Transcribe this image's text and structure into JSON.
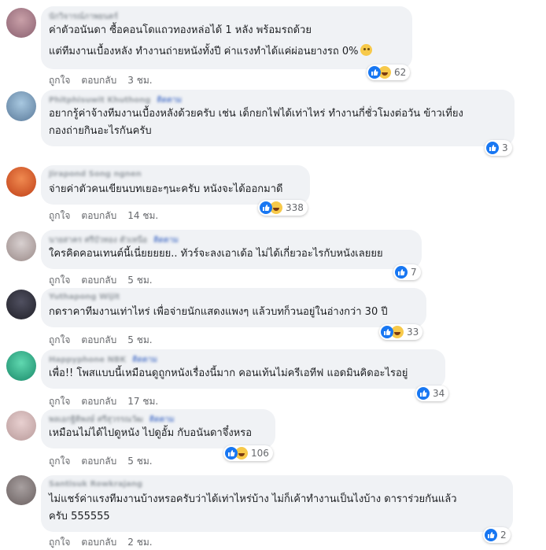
{
  "meta": {
    "like": "ถูกใจ",
    "reply": "ตอบกลับ"
  },
  "comments": [
    {
      "author": "นักวิจารณ์ภาพยนตร์",
      "tag": "",
      "lines": [
        "ค่าตัวอนันดา ซื้อคอนโดแถวทองหล่อได้ 1 หลัง พร้อมรถด้วย",
        "แต่ทีมงานเบื้องหลัง ทำงานถ่ายหนังทั้งปี ค่าแรงทำได้แค่ผ่อนยางรถ 0%"
      ],
      "time": "3 ชม.",
      "count": "62"
    },
    {
      "author": "Phitphisuwit Khuthong",
      "tag": "ติดตาม",
      "lines": [
        "อยากรู้ค่าจ้างทีมงานเบื้องหลังด้วยครับ เช่น เด็กยกไฟได้เท่าไหร่ ทำงานกี่ชั่วโมงต่อวัน ข้าวเที่ยง",
        "กองถ่ายกินอะไรกันครับ"
      ],
      "time": "",
      "count": "3"
    },
    {
      "author": "Jirapond Song ngnen",
      "tag": "",
      "lines": [
        "จ่ายค่าตัวคนเขียนบทเยอะๆนะครับ หนังจะได้ออกมาดี"
      ],
      "time": "14 ชม.",
      "count": "338"
    },
    {
      "author": "นายสาคร ศรีบัวทอง ตัวเหนือ",
      "tag": "ติดตาม",
      "lines": [
        "ใครคิดคอนเทนต์นี้เนี่ยยยยย.. ทัวร์จะลงเอาเด้อ ไม่ได้เกี่ยวอะไรกับหนังเลยยย"
      ],
      "time": "5 ชม.",
      "count": "7"
    },
    {
      "author": "Yuthapong Wijit",
      "tag": "",
      "lines": [
        "กดราคาทีมงานเท่าไหร่ เพื่อจ่ายนักแสดงแพงๆ แล้วบทก็วนอยู่ในอ่างกว่า 30 ปี"
      ],
      "time": "5 ชม.",
      "count": "33"
    },
    {
      "author": "Happyphone NBK",
      "tag": "ติดตาม",
      "lines": [
        "เพื่อ!! โพสแบบนี้เหมือนดูถูกหนังเรื่องนี้มาก คอนเท้นไม่ครีเอทีฟ แอดมินคิดอะไรอยู่"
      ],
      "time": "17 ชม.",
      "count": "34"
    },
    {
      "author": "พลเอกฐิติพงษ์ ศรีสุวรรณวัฒ",
      "tag": "ติดตาม",
      "lines": [
        "เหมือนไม่ได้ไปดูหนัง ไปดูอั้ม กับอนันดาจึ๋งหรอ"
      ],
      "time": "5 ชม.",
      "count": "106"
    },
    {
      "author": "Santisuk Rowkrajang",
      "tag": "",
      "lines": [
        "ไม่แชร์ค่าแรงทีมงานบ้างหรอครับว่าได้เท่าไหร่บ้าง ไม่ก็เค้าทำงานเป็นไงบ้าง ดาราร่วยกันแล้ว",
        "ครับ 555555"
      ],
      "time": "2 ชม.",
      "count": "2"
    }
  ]
}
